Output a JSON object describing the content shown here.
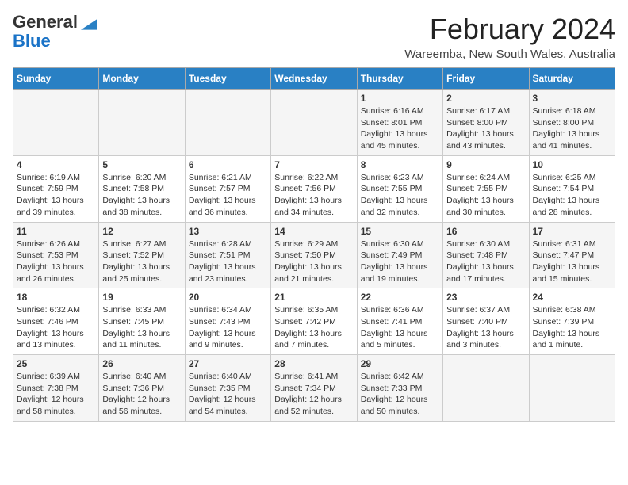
{
  "header": {
    "logo_line1": "General",
    "logo_line2": "Blue",
    "month": "February 2024",
    "location": "Wareemba, New South Wales, Australia"
  },
  "days_of_week": [
    "Sunday",
    "Monday",
    "Tuesday",
    "Wednesday",
    "Thursday",
    "Friday",
    "Saturday"
  ],
  "weeks": [
    [
      {
        "num": "",
        "detail": ""
      },
      {
        "num": "",
        "detail": ""
      },
      {
        "num": "",
        "detail": ""
      },
      {
        "num": "",
        "detail": ""
      },
      {
        "num": "1",
        "detail": "Sunrise: 6:16 AM\nSunset: 8:01 PM\nDaylight: 13 hours\nand 45 minutes."
      },
      {
        "num": "2",
        "detail": "Sunrise: 6:17 AM\nSunset: 8:00 PM\nDaylight: 13 hours\nand 43 minutes."
      },
      {
        "num": "3",
        "detail": "Sunrise: 6:18 AM\nSunset: 8:00 PM\nDaylight: 13 hours\nand 41 minutes."
      }
    ],
    [
      {
        "num": "4",
        "detail": "Sunrise: 6:19 AM\nSunset: 7:59 PM\nDaylight: 13 hours\nand 39 minutes."
      },
      {
        "num": "5",
        "detail": "Sunrise: 6:20 AM\nSunset: 7:58 PM\nDaylight: 13 hours\nand 38 minutes."
      },
      {
        "num": "6",
        "detail": "Sunrise: 6:21 AM\nSunset: 7:57 PM\nDaylight: 13 hours\nand 36 minutes."
      },
      {
        "num": "7",
        "detail": "Sunrise: 6:22 AM\nSunset: 7:56 PM\nDaylight: 13 hours\nand 34 minutes."
      },
      {
        "num": "8",
        "detail": "Sunrise: 6:23 AM\nSunset: 7:55 PM\nDaylight: 13 hours\nand 32 minutes."
      },
      {
        "num": "9",
        "detail": "Sunrise: 6:24 AM\nSunset: 7:55 PM\nDaylight: 13 hours\nand 30 minutes."
      },
      {
        "num": "10",
        "detail": "Sunrise: 6:25 AM\nSunset: 7:54 PM\nDaylight: 13 hours\nand 28 minutes."
      }
    ],
    [
      {
        "num": "11",
        "detail": "Sunrise: 6:26 AM\nSunset: 7:53 PM\nDaylight: 13 hours\nand 26 minutes."
      },
      {
        "num": "12",
        "detail": "Sunrise: 6:27 AM\nSunset: 7:52 PM\nDaylight: 13 hours\nand 25 minutes."
      },
      {
        "num": "13",
        "detail": "Sunrise: 6:28 AM\nSunset: 7:51 PM\nDaylight: 13 hours\nand 23 minutes."
      },
      {
        "num": "14",
        "detail": "Sunrise: 6:29 AM\nSunset: 7:50 PM\nDaylight: 13 hours\nand 21 minutes."
      },
      {
        "num": "15",
        "detail": "Sunrise: 6:30 AM\nSunset: 7:49 PM\nDaylight: 13 hours\nand 19 minutes."
      },
      {
        "num": "16",
        "detail": "Sunrise: 6:30 AM\nSunset: 7:48 PM\nDaylight: 13 hours\nand 17 minutes."
      },
      {
        "num": "17",
        "detail": "Sunrise: 6:31 AM\nSunset: 7:47 PM\nDaylight: 13 hours\nand 15 minutes."
      }
    ],
    [
      {
        "num": "18",
        "detail": "Sunrise: 6:32 AM\nSunset: 7:46 PM\nDaylight: 13 hours\nand 13 minutes."
      },
      {
        "num": "19",
        "detail": "Sunrise: 6:33 AM\nSunset: 7:45 PM\nDaylight: 13 hours\nand 11 minutes."
      },
      {
        "num": "20",
        "detail": "Sunrise: 6:34 AM\nSunset: 7:43 PM\nDaylight: 13 hours\nand 9 minutes."
      },
      {
        "num": "21",
        "detail": "Sunrise: 6:35 AM\nSunset: 7:42 PM\nDaylight: 13 hours\nand 7 minutes."
      },
      {
        "num": "22",
        "detail": "Sunrise: 6:36 AM\nSunset: 7:41 PM\nDaylight: 13 hours\nand 5 minutes."
      },
      {
        "num": "23",
        "detail": "Sunrise: 6:37 AM\nSunset: 7:40 PM\nDaylight: 13 hours\nand 3 minutes."
      },
      {
        "num": "24",
        "detail": "Sunrise: 6:38 AM\nSunset: 7:39 PM\nDaylight: 13 hours\nand 1 minute."
      }
    ],
    [
      {
        "num": "25",
        "detail": "Sunrise: 6:39 AM\nSunset: 7:38 PM\nDaylight: 12 hours\nand 58 minutes."
      },
      {
        "num": "26",
        "detail": "Sunrise: 6:40 AM\nSunset: 7:36 PM\nDaylight: 12 hours\nand 56 minutes."
      },
      {
        "num": "27",
        "detail": "Sunrise: 6:40 AM\nSunset: 7:35 PM\nDaylight: 12 hours\nand 54 minutes."
      },
      {
        "num": "28",
        "detail": "Sunrise: 6:41 AM\nSunset: 7:34 PM\nDaylight: 12 hours\nand 52 minutes."
      },
      {
        "num": "29",
        "detail": "Sunrise: 6:42 AM\nSunset: 7:33 PM\nDaylight: 12 hours\nand 50 minutes."
      },
      {
        "num": "",
        "detail": ""
      },
      {
        "num": "",
        "detail": ""
      }
    ]
  ]
}
